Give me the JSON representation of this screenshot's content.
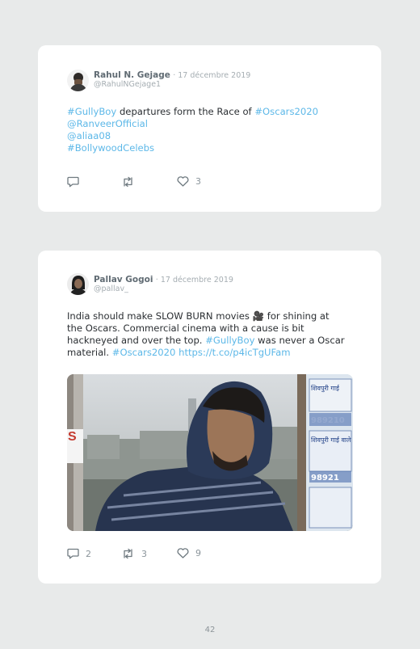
{
  "tweets": [
    {
      "author": "Rahul N. Gejage",
      "date": "· 17 décembre 2019",
      "handle": "@RahulNGejage1",
      "lines": [
        {
          "tag": "#GullyBoy",
          "text": " departures form the Race of ",
          "tag2": "#Oscars2020"
        },
        {
          "tag": "@RanveerOfficial"
        },
        {
          "tag": "@aliaa08"
        },
        {
          "tag": "#BollywoodCelebs"
        }
      ],
      "replies": "",
      "retweets": "",
      "likes": "3"
    },
    {
      "author": "Pallav Gogoi",
      "date": "· 17 décembre 2019",
      "handle": "@pallav_",
      "lines": [
        {
          "text": "India should make SLOW BURN movies 🎥 for shining at"
        },
        {
          "text": "the Oscars. Commercial cinema with a cause is bit"
        },
        {
          "text": "hackneyed and over the top. ",
          "tag": "#GullyBoy",
          "text2": " was never a Oscar"
        },
        {
          "text": "material. ",
          "tag": "#Oscars2020",
          "link": " https://t.co/p4icTgUFam"
        }
      ],
      "poster_text": {
        "side_letter": "S",
        "p1": "शिवपुरी गाई",
        "p2": "989210",
        "p3": "शिवपुरी गाई वाले",
        "p4": "98921"
      },
      "replies": "2",
      "retweets": "3",
      "likes": "9"
    }
  ],
  "page_number": "42",
  "colors": {
    "accent": "#5db8e8",
    "background": "#e8eaea",
    "card": "#ffffff"
  },
  "icons": [
    "reply-icon",
    "retweet-icon",
    "like-icon"
  ]
}
